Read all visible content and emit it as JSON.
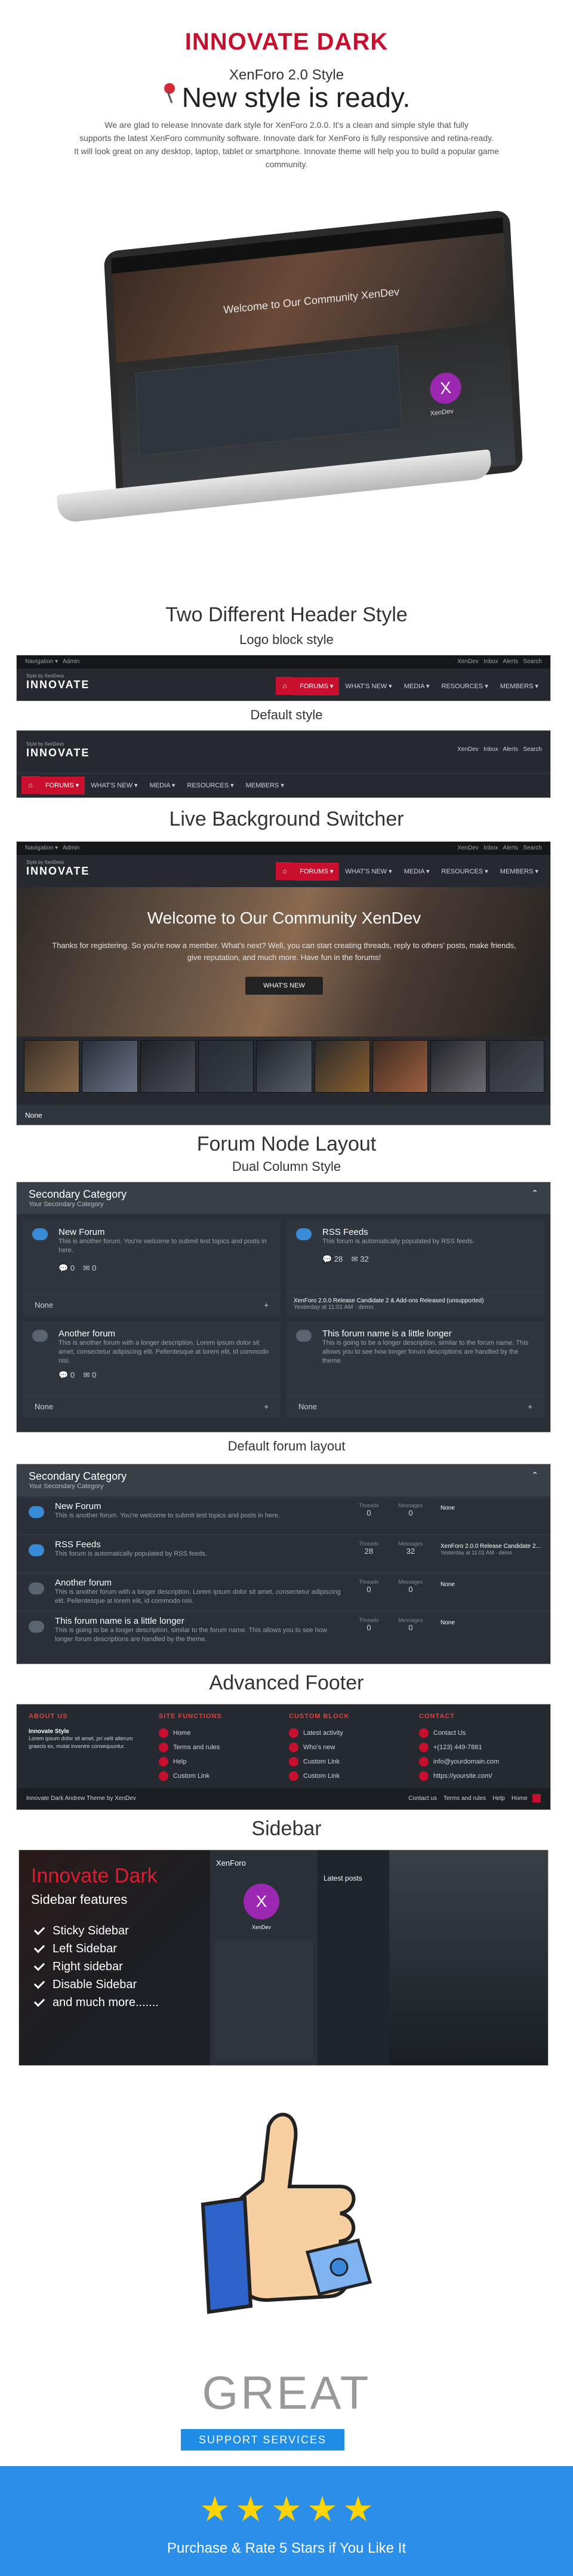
{
  "header": {
    "brand": "INNOVATE DARK",
    "subtitle": "XenForo 2.0 Style",
    "headline": "New style is ready.",
    "intro": [
      "We are glad to release Innovate dark style for XenForo 2.0.0. It's a clean and simple style that fully",
      "supports the latest XenForo community software. Innovate dark for XenForo is fully responsive and retina-ready.",
      "It will look great on any desktop, laptop, tablet or smartphone. Innovate theme will help you to build a popular game community."
    ]
  },
  "laptop": {
    "welcome": "Welcome to Our Community XenDev",
    "avatar_letter": "X",
    "avatar_name": "XenDev"
  },
  "sections": {
    "header_styles": "Two Different Header Style",
    "logo_block": "Logo block style",
    "default_style": "Default style",
    "bg_switcher": "Live Background Switcher",
    "forum_node": "Forum Node Layout",
    "dual_column": "Dual Column Style",
    "default_forum": "Default forum layout",
    "advanced_footer": "Advanced Footer",
    "sidebar": "Sidebar"
  },
  "navbar": {
    "top_left": [
      "Navigation ▾",
      "Admin"
    ],
    "top_right": [
      "XenDev",
      "Inbox",
      "Alerts",
      "Search"
    ],
    "logo_small": "Style by XenDevs",
    "logo": "INNOVATE",
    "items": [
      "FORUMS ▾",
      "WHAT'S NEW ▾",
      "MEDIA ▾",
      "RESOURCES ▾",
      "MEMBERS ▾"
    ]
  },
  "hero": {
    "title": "Welcome to Our Community XenDev",
    "text": "Thanks for registering. So you're now a member. What's next? Well, you can start creating threads, reply to others' posts, make friends, give reputation, and much more. Have fun in the forums!",
    "button": "WHAT'S NEW",
    "footer_label": "None"
  },
  "dual": {
    "category": "Secondary Category",
    "category_sub": "Your Secondary Category",
    "nodes": [
      {
        "title": "New Forum",
        "desc": "This is another forum. You're welcome to submit test topics and posts in here.",
        "threads": "0",
        "messages": "0",
        "last": "None"
      },
      {
        "title": "RSS Feeds",
        "desc": "This forum is automatically populated by RSS feeds.",
        "threads": "28",
        "messages": "32",
        "last": "XenForo 2.0.0 Release Candidate 2 & Add-ons Released (unsupported)",
        "last_meta": "Yesterday at 11:01 AM · demo"
      },
      {
        "title": "Another forum",
        "desc": "This is another forum with a longer description. Lorem ipsum dolor sit amet, consectetur adipiscing elit. Pellentesque at lorem elit, id commodo nisi.",
        "threads": "0",
        "messages": "0",
        "last": "None"
      },
      {
        "title": "This forum name is a little longer",
        "desc": "This is going to be a longer description, similar to the forum name. This allows you to see how longer forum descriptions are handled by the theme.",
        "threads": "0",
        "messages": "0",
        "last": "None"
      }
    ]
  },
  "list": {
    "category": "Secondary Category",
    "category_sub": "Your Secondary Category",
    "col_threads": "Threads",
    "col_messages": "Messages",
    "rows": [
      {
        "title": "New Forum",
        "desc": "This is another forum. You're welcome to submit test topics and posts in here.",
        "threads": "0",
        "messages": "0",
        "last": "None"
      },
      {
        "title": "RSS Feeds",
        "desc": "This forum is automatically populated by RSS feeds.",
        "threads": "28",
        "messages": "32",
        "last": "XenForo 2.0.0 Release Candidate 2...",
        "last_meta": "Yesterday at 11:01 AM · demo"
      },
      {
        "title": "Another forum",
        "desc": "This is another forum with a longer description. Lorem ipsum dolor sit amet, consectetur adipiscing elit. Pellentesque at lorem elit, id commodo nisi.",
        "threads": "0",
        "messages": "0",
        "last": "None"
      },
      {
        "title": "This forum name is a little longer",
        "desc": "This is going to be a longer description, similar to the forum name. This allows you to see how longer forum descriptions are handled by the theme.",
        "threads": "0",
        "messages": "0",
        "last": "None"
      }
    ]
  },
  "footer": {
    "cols": [
      {
        "head": "ABOUT US",
        "title": "Innovate Style",
        "text": "Lorem ipsum dolor sit amet, pri velit alterum graecis ex, mutat invenire consequuntur."
      },
      {
        "head": "SITE FUNCTIONS",
        "links": [
          "Home",
          "Terms and rules",
          "Help",
          "Custom Link"
        ]
      },
      {
        "head": "CUSTOM BLOCK",
        "links": [
          "Latest activity",
          "Who's new",
          "Custom Link",
          "Custom Link"
        ]
      },
      {
        "head": "CONTACT",
        "links": [
          "Contact Us",
          "+(123) 449-7881",
          "info@yourdomain.com",
          "https://yoursite.com/"
        ]
      }
    ],
    "bottom_left": "Innovate Dark   Andrew Theme by XenDev",
    "bottom_right": [
      "Contact us",
      "Terms and rules",
      "Help",
      "Home"
    ]
  },
  "sidebar_preview": {
    "title": "Innovate Dark",
    "subtitle": "Sidebar features",
    "features": [
      "Sticky Sidebar",
      "Left Sidebar",
      "Right sidebar",
      "Disable Sidebar",
      "and much more......."
    ],
    "panel_title": "XenForo",
    "user": "XenDev",
    "latest": "Latest posts"
  },
  "cta": {
    "great": "GREAT",
    "support": "SUPPORT SERVICES",
    "rate": "Purchase & Rate 5 Stars if You Like It"
  },
  "colors": {
    "accent": "#c8102e",
    "dark": "#262a30",
    "blue": "#2b8ee8",
    "star": "#ffd400"
  }
}
